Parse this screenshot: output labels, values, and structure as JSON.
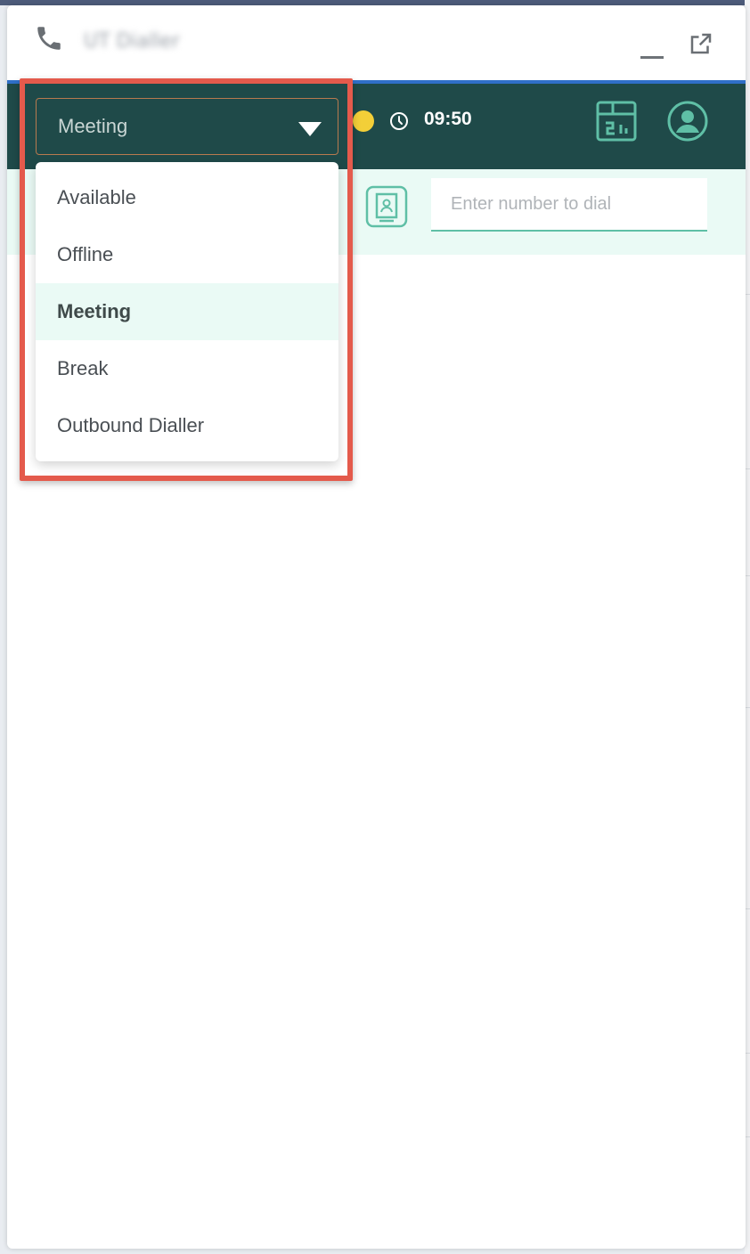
{
  "window": {
    "title": "UT Dialler",
    "icons": {
      "phone": "phone-icon",
      "minimize": "minimize-icon",
      "popout": "external-link-icon"
    }
  },
  "header": {
    "status_selected": "Meeting",
    "status_color": "#f3cf38",
    "timer": "09:50",
    "icons": [
      "clock-icon",
      "report-icon",
      "profile-icon"
    ]
  },
  "status_menu": {
    "items": [
      {
        "label": "Available",
        "selected": false
      },
      {
        "label": "Offline",
        "selected": false
      },
      {
        "label": "Meeting",
        "selected": true
      },
      {
        "label": "Break",
        "selected": false
      },
      {
        "label": "Outbound Dialler",
        "selected": false
      }
    ]
  },
  "dialer": {
    "placeholder": "Enter number to dial",
    "contacts_icon": "contacts-icon"
  },
  "colors": {
    "header_bg": "#1f4a49",
    "accent": "#5fbfa6",
    "highlight": "#e45a4c",
    "title_underline": "#2f6fc8"
  }
}
